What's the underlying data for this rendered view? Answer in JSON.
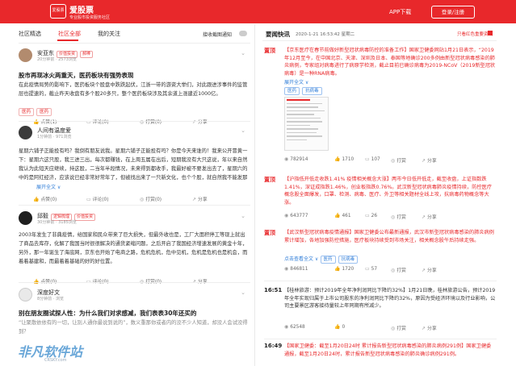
{
  "header": {
    "logo_text": "爱股票",
    "brand": "爱股票",
    "slogan": "专业股市投资服务社区",
    "app_download": "APP下载",
    "login": "登录/注册"
  },
  "tabs": [
    "社区精选",
    "社区全部",
    "我的关注"
  ],
  "receive_notice": "接收截图通知",
  "posts": [
    {
      "user": "安亚东",
      "badge": "价值投资",
      "badge2": "郝棒",
      "meta": "20分钟前 · 2573浏览",
      "title": "股市再现冰火两重天，医药板块有强势表现",
      "body": "在此疫情局势的影响下，医药板块个股盘中跌跌起伏，江浙一带的游资大举们，对此跟进涉事件的监管层也提速的，截止昨天收盘有多个股20多只，整个医药板块涉及其余道上涨建近1000亿。",
      "tags": [
        "医药",
        "医药"
      ],
      "likes": "点赞(1)",
      "comments": "评论(0)",
      "reward": "打赏(0)",
      "share": "分享"
    },
    {
      "user": "人间有温度爱",
      "meta": "1分钟前 · 971浏览",
      "title": "",
      "body": "星期六铺子正能投有吗？我倒有朋友说我。星期六铺子正能投有吗？你是今天来谁的！我来公开冒黄一下：星期六这只股，我三进三出，每次都赚钱，在上周五属在出后，短期我没有大只这说，年以来自然我认为此短天应继续，持这股，二当年半段情况，未来得到都收手，我最好被不要发出去了，星期六的中的是阿红经济，应该说已经非常好常年了，但被找出来了一只新文化，也个个股，就自然我不能发那么，",
      "more": "展开全文 ∨",
      "likes": "点赞(0)",
      "comments": "评论(0)",
      "reward": "打赏(0)",
      "share": "分享"
    },
    {
      "user": "邱毅",
      "badge": "逻辑梳理",
      "badge2": "价值投资",
      "meta": "30分钟前 · 3185浏览",
      "title": "",
      "body": "2003年发生了非典疫情，给国家和民众带来了巨大损失，但最外收也是，工厂大面积停工等现上就出了商品去库存，化解了我国当时很很解决的通货紧缩问题，之后开启了我国经济增速发展的黄金十年，另外，那一年诞生了海底网，京东也开始了电商之路，危机危机，危中见机，危机是危机也是机会，而着着基建和，而最着着基础的好的好位置。",
      "likes": "点赞(0)",
      "comments": "评论(0)",
      "reward": "打赏(0)",
      "share": "分享"
    },
    {
      "user": "深度好文",
      "meta": "8分钟前 · 浏览",
      "title": "别在朋友圈试探人性：为什么我们对求感减，我们表表30年还买的",
      "body": "“让聚散依依有的一切，让别人通你最说到说的”，数义重那你或者内的没不少人知道，却没人会试没得到？",
      "likes": "",
      "comments": "",
      "reward": "",
      "share": ""
    }
  ],
  "news": {
    "title": "要闻快讯",
    "date": "2020-1-21 16:53:42 星期二",
    "hot_only": "只看红色重要资讯",
    "items": [
      {
        "time": "置顶",
        "text": "【京东医疗在春节前做好新型冠状病毒防控的准备工作】国家卫健委网站1月21日表示，“2019年12月至今，在中国北京、天津、深圳及日本、泰国等地确诊200多例由新型冠状病毒感染的肺炎病例，专家组对病毒进行了病原学检测，截止目前已确诊病毒为2019-NCoV（2019新型冠状病毒）是一种RNA病毒。",
        "more": "展开全文 ∨",
        "tags": [
          "医药",
          "抗病毒"
        ],
        "views": "782914",
        "likes": "1710",
        "comments": "107",
        "reward": "打赏",
        "share": "分享",
        "red": true
      },
      {
        "time": "置顶",
        "text": "【沪指低开低走收跌1.41% 疫情相关概念大涨】两市今日低开低走，截至收盘，上证指数跌1.41%，深证成指跌1.46%，创业板指跌0.76%。武汉新型冠状病毒肺炎疫情持续，防控医疗概念股全面爆发，口罩、检测、病毒、医疗、外卫等相关题材全线上攻，抗病毒药物概念等大涨。",
        "views": "643777",
        "likes": "461",
        "comments": "26",
        "reward": "打赏",
        "share": "分享",
        "red": true
      },
      {
        "time": "置顶",
        "text": "【武汉新型冠状病毒疫情通报】国家卫健委公布最新通报，武汉市新型冠状病毒感染的肺炎病例累计增加，各地加强防控措施，医疗板块持续受到市场关注，相关概念股午后持续走强。",
        "more": "点击查看全文 ∨",
        "tags": [
          "医药",
          "抗病毒"
        ],
        "views": "846811",
        "likes": "1720",
        "comments": "57",
        "reward": "打赏",
        "share": "分享",
        "red": true
      },
      {
        "time": "16:51",
        "text": "【桂林旅游：预计2019年全年净利润同比下降约32%】1月21日晚，桂林旅游公告，预计2019年全年实现归属于上市公司股东的净利润同比下降约32%，原因为受经济环境以及行业影响，公司主要景区游客接待量较上年同期有所减少。",
        "views": "62548",
        "likes": "0",
        "comments": "",
        "reward": "打赏",
        "share": "分享",
        "red": false
      },
      {
        "time": "16:49",
        "text": "【国家卫健委：截至1月20日24时 累计报告新型冠状病毒感染的肺炎病例291例】国家卫健委通报，截至1月20日24时，累计报告新型冠状病毒感染的肺炎确诊病例291例。",
        "views": "",
        "likes": "",
        "comments": "",
        "reward": "",
        "share": "",
        "red": true
      }
    ]
  },
  "watermark": {
    "main": "非凡软件站",
    "sub": "CRSKY.com"
  }
}
